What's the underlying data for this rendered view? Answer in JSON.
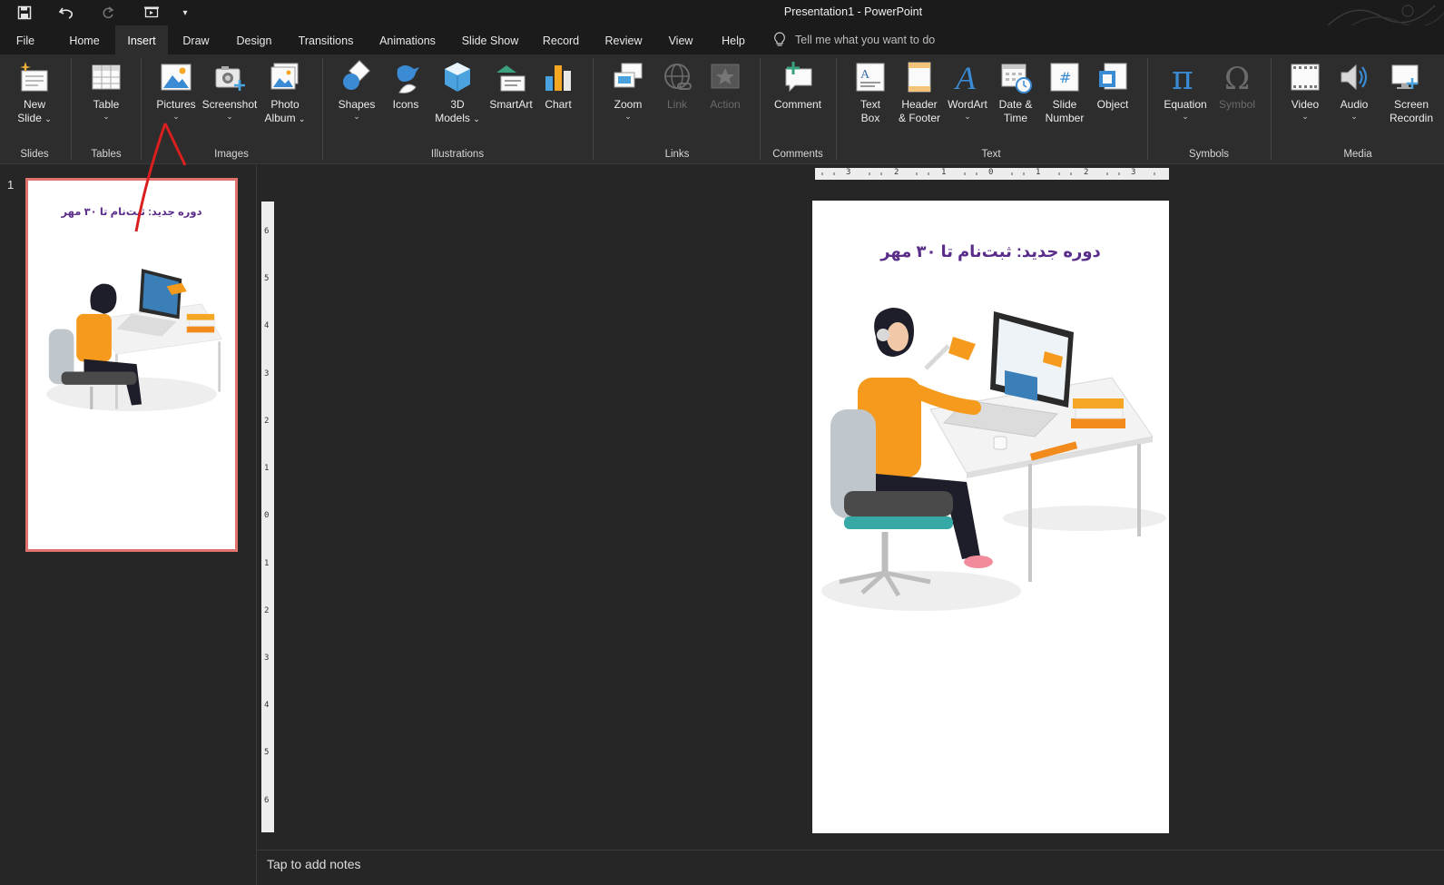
{
  "window": {
    "title": "Presentation1  -  PowerPoint"
  },
  "tabs": [
    {
      "label": "File"
    },
    {
      "label": "Home"
    },
    {
      "label": "Insert"
    },
    {
      "label": "Draw"
    },
    {
      "label": "Design"
    },
    {
      "label": "Transitions"
    },
    {
      "label": "Animations"
    },
    {
      "label": "Slide Show"
    },
    {
      "label": "Record"
    },
    {
      "label": "Review"
    },
    {
      "label": "View"
    },
    {
      "label": "Help"
    }
  ],
  "active_tab": "Insert",
  "tell_me": {
    "placeholder": "Tell me what you want to do"
  },
  "ribbon": {
    "new_slide": [
      "New",
      "Slide"
    ],
    "table": "Table",
    "pictures": "Pictures",
    "screenshot": "Screenshot",
    "photo_album": [
      "Photo",
      "Album"
    ],
    "shapes": "Shapes",
    "icons": "Icons",
    "models_3d": [
      "3D",
      "Models"
    ],
    "smartart": "SmartArt",
    "chart": "Chart",
    "zoom": "Zoom",
    "link": "Link",
    "action": "Action",
    "comment": "Comment",
    "text_box": [
      "Text",
      "Box"
    ],
    "header_footer": [
      "Header",
      "& Footer"
    ],
    "wordart": "WordArt",
    "date_time": [
      "Date &",
      "Time"
    ],
    "slide_number": [
      "Slide",
      "Number"
    ],
    "object": "Object",
    "equation": "Equation",
    "symbol": "Symbol",
    "video": "Video",
    "audio": "Audio",
    "screen_recording": [
      "Screen",
      "Recordin"
    ],
    "groups": {
      "slides": "Slides",
      "tables": "Tables",
      "images": "Images",
      "illustrations": "Illustrations",
      "links": "Links",
      "comments": "Comments",
      "text": "Text",
      "symbols": "Symbols",
      "media": "Media"
    }
  },
  "thumbnails": [
    {
      "number": "1",
      "title": "دوره جدید: ثبت‌نام تا ۳۰ مهر"
    }
  ],
  "slide": {
    "title": "دوره جدید: ثبت‌نام تا ۳۰ مهر"
  },
  "ruler": {
    "horizontal": [
      "3",
      "2",
      "1",
      "0",
      "1",
      "2",
      "3"
    ],
    "vertical": [
      "6",
      "5",
      "4",
      "3",
      "2",
      "1",
      "0",
      "1",
      "2",
      "3",
      "4",
      "5",
      "6"
    ]
  },
  "notes": {
    "placeholder": "Tap to add notes"
  },
  "colors": {
    "title_purple": "#5a2d8a",
    "accent_red": "#e0736d",
    "ribbon_bg": "#2d2d2d",
    "titlebar_bg": "#1b1b1b"
  }
}
